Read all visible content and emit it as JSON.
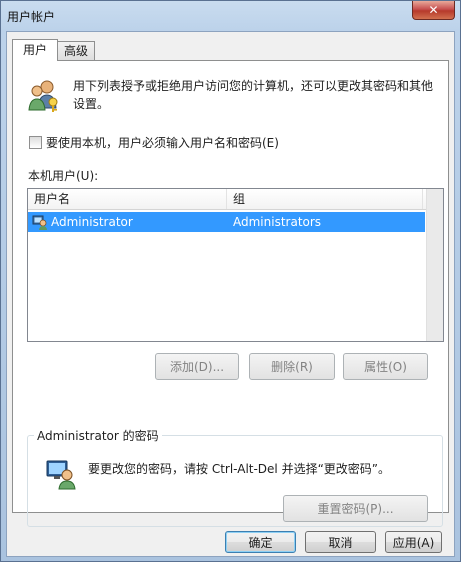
{
  "window": {
    "title": "用户帐户",
    "close_label": "✕"
  },
  "tabs": [
    {
      "label": "用户"
    },
    {
      "label": "高级"
    }
  ],
  "description": "用下列表授予或拒绝用户访问您的计算机，还可以更改其密码和其他设置。",
  "checkbox": {
    "label": "要使用本机，用户必须输入用户名和密码(E)",
    "checked": false
  },
  "list": {
    "label": "本机用户(U):",
    "columns": [
      "用户名",
      "组"
    ],
    "rows": [
      {
        "username": "Administrator",
        "group": "Administrators",
        "selected": true
      }
    ]
  },
  "list_buttons": {
    "add": "添加(D)...",
    "remove": "删除(R)",
    "properties": "属性(O)"
  },
  "password_group": {
    "title": "Administrator 的密码",
    "text": "要更改您的密码，请按 Ctrl-Alt-Del 并选择“更改密码”。",
    "reset_button": "重置密码(P)..."
  },
  "footer": {
    "ok": "确定",
    "cancel": "取消",
    "apply": "应用(A)"
  },
  "colors": {
    "selection": "#3399ff",
    "close_button": "#c75050"
  }
}
